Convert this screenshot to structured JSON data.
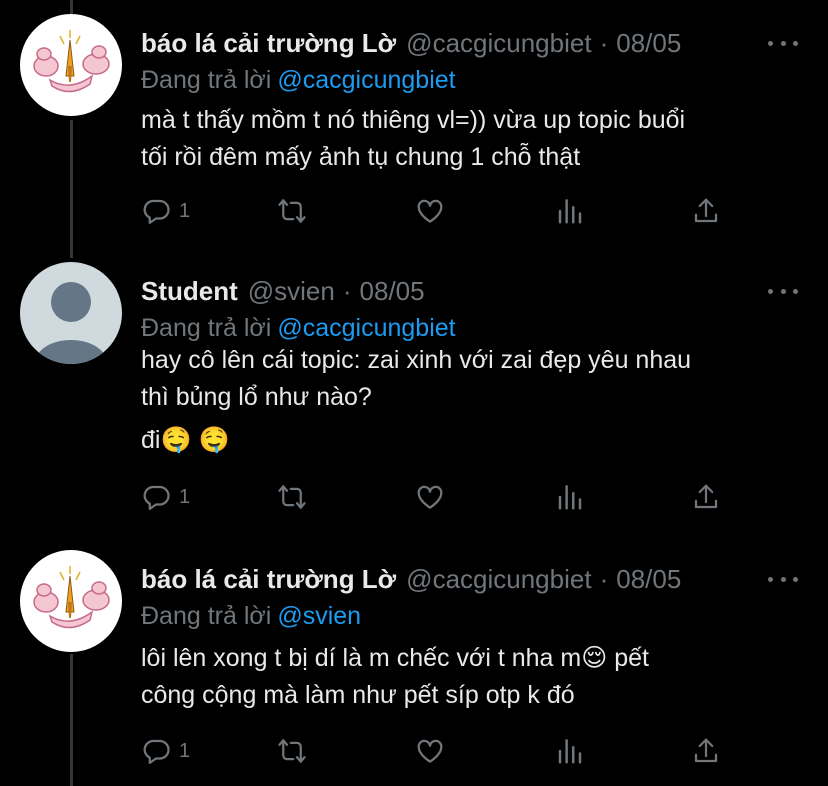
{
  "colors": {
    "background": "#000000",
    "text": "#e7e9ea",
    "muted": "#71767b",
    "link": "#1d9bf0",
    "thread_line": "#333639"
  },
  "tweets": [
    {
      "display_name": "báo lá cải trường Lờ",
      "handle": "@cacgicungbiet",
      "separator": "·",
      "date": "08/05",
      "reply_prefix": "Đang trả lời",
      "reply_to": "@cacgicungbiet",
      "lines": [
        "mà t thấy mồm t nó thiêng vl=)) vừa up topic buổi",
        "tối rồi đêm mấy ảnh tụ chung 1 chỗ thật"
      ],
      "reply_count": "1",
      "avatar": "cartoon-avatar"
    },
    {
      "display_name": "Student",
      "handle": "@svien",
      "separator": "·",
      "date": "08/05",
      "reply_prefix": "Đang trả lời",
      "reply_to": "@cacgicungbiet",
      "lines": [
        "hay cô lên cái topic: zai xinh với zai đẹp yêu nhau",
        "thì bủng lổ như nào?",
        "đi🤤 🤤"
      ],
      "reply_count": "1",
      "avatar": "default-avatar"
    },
    {
      "display_name": "báo lá cải trường Lờ",
      "handle": "@cacgicungbiet",
      "separator": "·",
      "date": "08/05",
      "reply_prefix": "Đang trả lời",
      "reply_to": "@svien",
      "lines": [
        "lôi lên xong t bị dí là m chếc với t nha m😌  pết",
        "công cộng mà làm như pết síp otp k đó"
      ],
      "reply_count": "1",
      "avatar": "cartoon-avatar"
    }
  ]
}
